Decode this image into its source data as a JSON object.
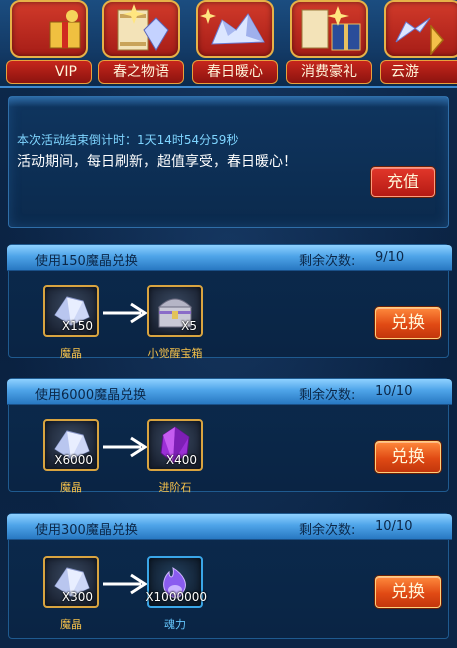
{
  "tabs": [
    {
      "label": "VIP"
    },
    {
      "label": "春之物语"
    },
    {
      "label": "春日暖心"
    },
    {
      "label": "消费豪礼"
    },
    {
      "label": "云游"
    }
  ],
  "event": {
    "countdown": "本次活动结束倒计时：1天14时54分59秒",
    "description": "活动期间，每日刷新，超值享受，春日暖心！",
    "recharge_label": "充值"
  },
  "exchanges": [
    {
      "title": "使用150魔晶兑换",
      "remain_label": "剩余次数:",
      "remain_value": "9/10",
      "cost_qty": "X150",
      "cost_name": "魔晶",
      "reward_qty": "X5",
      "reward_name": "小觉醒宝箱",
      "button_label": "兑换"
    },
    {
      "title": "使用6000魔晶兑换",
      "remain_label": "剩余次数:",
      "remain_value": "10/10",
      "cost_qty": "X6000",
      "cost_name": "魔晶",
      "reward_qty": "X400",
      "reward_name": "进阶石",
      "button_label": "兑换"
    },
    {
      "title": "使用300魔晶兑换",
      "remain_label": "剩余次数:",
      "remain_value": "10/10",
      "cost_qty": "X300",
      "cost_name": "魔晶",
      "reward_qty": "X1000000",
      "reward_name": "魂力",
      "button_label": "兑换"
    }
  ],
  "icons": {
    "left_arrow": "chevron-left-icon",
    "right_arrow": "chevron-right-icon",
    "crystal": "magic-crystal-icon",
    "chest": "treasure-chest-icon",
    "gem": "purple-gem-icon",
    "soul": "soul-flame-icon"
  },
  "colors": {
    "accent_gold": "#d9a440",
    "button_orange": "#e04a14",
    "header_blue": "#4ea4e8",
    "countdown_cyan": "#7fd5ff"
  }
}
